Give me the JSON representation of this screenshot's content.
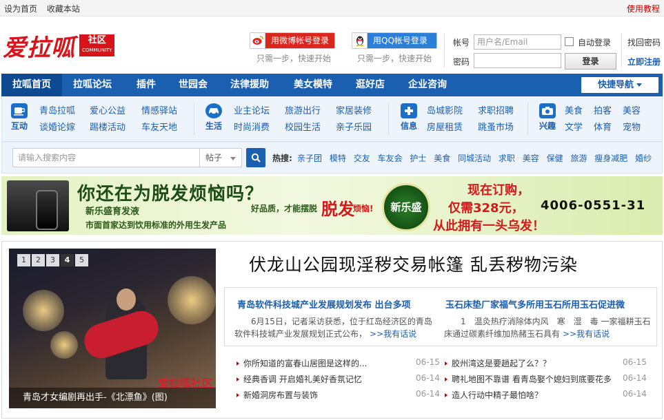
{
  "topbar": {
    "set_home": "设为首页",
    "bookmark": "收藏本站",
    "help": "使用教程"
  },
  "logo": {
    "text": "爱拉呱",
    "badge": "社区",
    "badge_sub": "COMMUNITY"
  },
  "login": {
    "weibo_btn": "用微博帐号登录",
    "qq_btn": "用QQ帐号登录",
    "hint": "只需一步，快速开始",
    "account_label": "帐号",
    "password_label": "密码",
    "username_placeholder": "用户名/Email",
    "auto_login": "自动登录",
    "submit": "登录",
    "find_password": "找回密码",
    "register": "立即注册"
  },
  "nav": {
    "items": [
      "拉呱首页",
      "拉呱论坛",
      "插件",
      "世园会",
      "法律援助",
      "美女模特",
      "逛好店",
      "企业咨询"
    ],
    "quick": "快捷导航"
  },
  "categories": [
    {
      "name": "互动",
      "icon": "cup-icon",
      "links": [
        "青岛拉呱",
        "爱心公益",
        "情感驿站",
        "谈婚论嫁",
        "踢楼活动",
        "车友天地"
      ]
    },
    {
      "name": "生活",
      "icon": "car-icon",
      "links": [
        "业主论坛",
        "旅游出行",
        "家居装修",
        "时尚消费",
        "校园生活",
        "亲子乐园"
      ]
    },
    {
      "name": "信息",
      "icon": "medkit-icon",
      "links": [
        "岛城影院",
        "求职招聘",
        "房屋租赁",
        "跳蚤市场"
      ]
    },
    {
      "name": "兴趣",
      "icon": "camera-icon",
      "links": [
        "美食",
        "拍客",
        "美容",
        "文学",
        "体育",
        "宠物"
      ]
    }
  ],
  "search": {
    "placeholder": "请输入搜索内容",
    "type": "帖子",
    "hot_label": "热搜:",
    "hot": [
      "亲子团",
      "模特",
      "交友",
      "车友会",
      "护士",
      "美食",
      "同城活动",
      "求职",
      "美容",
      "保健",
      "旅游",
      "瘦身减肥",
      "婚纱"
    ]
  },
  "banner": {
    "headline": "你还在为脱发烦恼吗？",
    "sub1": "新乐盛育发液",
    "sub2": "市面首家达到饮用标准的外用生发产品",
    "mid_a": "好品质，才能摆脱",
    "mid_b": "脱发",
    "mid_c": "烦恼!",
    "seal": "新乐盛",
    "ordering": "现在订购，",
    "price": "仅需328元，",
    "phone": "4006-0551-31",
    "slogan": "从此拥有一头乌发！"
  },
  "news": {
    "slider_pages": [
      "1",
      "2",
      "3",
      "4",
      "5"
    ],
    "slider_active": 3,
    "slide_caption": "青岛才女编剧再出手-《北漂鱼》(图)",
    "slide_watermark": "爱拉呱社区",
    "headline": "伏龙山公园现淫秽交易帐篷 乱丢秽物污染",
    "features": [
      {
        "title": "青岛软件科技城产业发展规划发布 出台多项",
        "body": "6月15日，记者采访获悉，位于红岛经济区的青岛软件科技城产业发展规划正式公布，",
        "more": ">>我有话说"
      },
      {
        "title": "玉石床垫厂家福气多所用玉石所用玉石促进微",
        "body": "1　温灸热疗消除体内风　寒　湿　毒 一家福耕玉石床通过碳素纤维加热赭玉石具有",
        "more": ">>我有话说"
      }
    ],
    "left_list": [
      {
        "title": "你所知道的富春山居图是这样的...",
        "date": "06-15"
      },
      {
        "title": "经典香调 开启婚礼美好香氛记忆",
        "date": "06-14"
      },
      {
        "title": "新婚洞房布置与装饰",
        "date": "06-14"
      }
    ],
    "right_list": [
      {
        "title": "胶州湾这是要趟起了么？？",
        "date": "06-15"
      },
      {
        "title": "聘礼地图不靠谱 看青岛娶个媳妇到底要花多",
        "date": "06-14"
      },
      {
        "title": "造人行动中精子最怕啥？",
        "date": "06-14"
      }
    ]
  }
}
